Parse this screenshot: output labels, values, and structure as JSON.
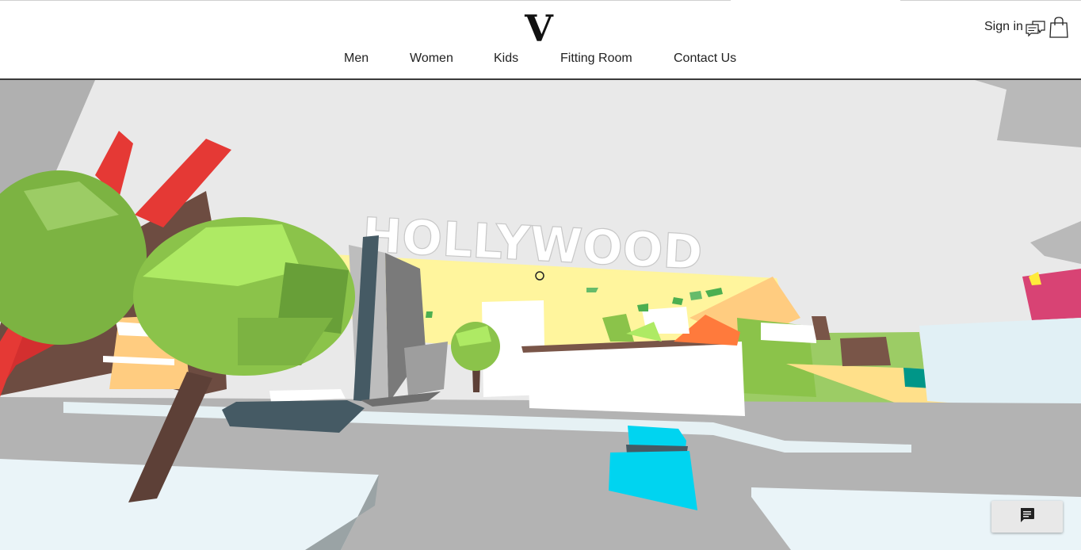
{
  "brand": {
    "logo_letter": "V"
  },
  "nav": {
    "items": [
      {
        "label": "Men"
      },
      {
        "label": "Women"
      },
      {
        "label": "Kids"
      },
      {
        "label": "Fitting Room"
      },
      {
        "label": "Contact Us"
      }
    ]
  },
  "account": {
    "sign_in_label": "Sign in"
  },
  "icons": {
    "chat": "chat-bubbles-icon",
    "bag": "shopping-bag-icon",
    "fab": "message-icon"
  },
  "scene": {
    "sign_text": "HOLLYWOOD"
  },
  "colors": {
    "sky": "#e9e9e9",
    "road": "#b3b3b3",
    "grass": "#8bc34a",
    "sand": "#fff59d",
    "tree_light": "#8bc34a",
    "trunk": "#5d4037",
    "red": "#d32f2f",
    "cyan": "#00d4f0",
    "orange": "#ffa000",
    "teal": "#009688"
  }
}
